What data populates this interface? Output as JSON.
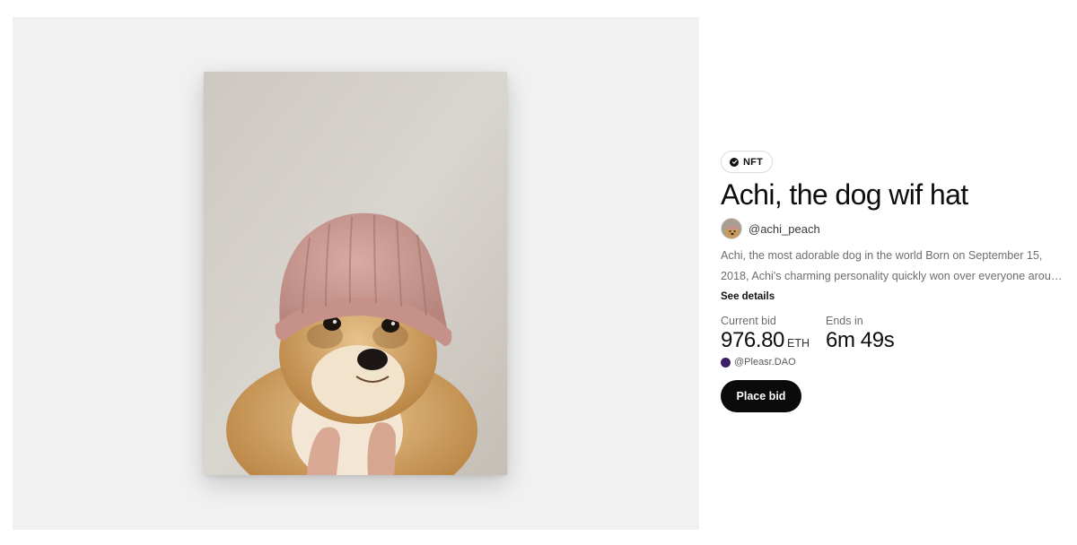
{
  "artwork": {
    "icon": "shiba-dog-wearing-pink-knit-hat"
  },
  "badge": {
    "label": "NFT",
    "icon": "check-circle-icon"
  },
  "title": "Achi, the dog wif hat",
  "creator": {
    "handle": "@achi_peach",
    "avatar_icon": "dog-avatar"
  },
  "description": {
    "line1": "Achi, the most adorable dog in the world Born on September 15,",
    "line2": "2018, Achi's charming personality quickly won over everyone aroun..."
  },
  "see_details": "See details",
  "auction": {
    "current_bid_label": "Current bid",
    "current_bid_value": "976.80",
    "current_bid_unit": "ETH",
    "ends_in_label": "Ends in",
    "ends_in_value": "6m 49s",
    "top_bidder": "@Pleasr.DAO",
    "bidder_color": "#3b1f66"
  },
  "actions": {
    "place_bid": "Place bid"
  },
  "colors": {
    "panel_background": "#f1f1f1",
    "button_background": "#0b0b0b",
    "hat_pink": "#c99a92"
  }
}
